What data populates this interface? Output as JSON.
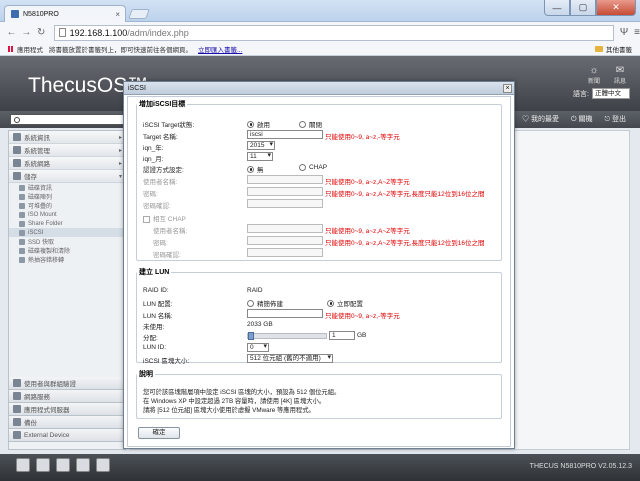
{
  "browser": {
    "tab_title": "N5810PRO",
    "url_host": "192.168.1.100",
    "url_path": "/adm/index.php",
    "bookmarks": {
      "apps_label": "應用程式",
      "hint_text": "將書籤放置於書籤列上，即可快速前往各個網頁。",
      "import_link": "立即匯入書籤...",
      "other_label": "其他書籤"
    },
    "window_buttons": [
      "—",
      "▢",
      "✕"
    ]
  },
  "app": {
    "logo": "ThecusOS™",
    "header_icons": [
      {
        "icon": "rss-icon",
        "label": "新聞"
      },
      {
        "icon": "chat-icon",
        "label": "訊息"
      }
    ],
    "language_label": "語言:",
    "language_value": "正體中文",
    "action_links": [
      "我的最愛",
      "關機",
      "登出"
    ],
    "version": "THECUS N5810PRO V2.05.12.3"
  },
  "sidebar": {
    "sections": [
      {
        "label": "系統資訊"
      },
      {
        "label": "系統管理"
      },
      {
        "label": "系統網路"
      },
      {
        "label": "儲存"
      }
    ],
    "storage_items": [
      {
        "label": "磁碟資訊"
      },
      {
        "label": "磁碟陣列"
      },
      {
        "label": "可堆疊的"
      },
      {
        "label": "ISO Mount"
      },
      {
        "label": "Share Folder"
      },
      {
        "label": "iSCSI"
      },
      {
        "label": "SSD 快取"
      },
      {
        "label": "磁碟複製和清除"
      },
      {
        "label": "熱抽容錯移轉"
      }
    ],
    "bottom_sections": [
      {
        "label": "使用者與群組驗證"
      },
      {
        "label": "網路服務"
      },
      {
        "label": "應用程式伺服器"
      },
      {
        "label": "備份"
      },
      {
        "label": "External Device"
      }
    ]
  },
  "dialog": {
    "title": "iSCSI",
    "close_label": "×",
    "target_section": {
      "legend": "增加iSCSI目標",
      "iscsi_target_label": "iSCSI Target狀態:",
      "enable_label": "啟用",
      "disable_label": "關閉",
      "target_name_label": "Target 名稱:",
      "target_name_value": "iscsi",
      "name_hint": "只能使用0~9, a~z,-等字元",
      "iqn_year_label": "iqn_年:",
      "iqn_year_value": "2015",
      "iqn_month_label": "iqn_月:",
      "iqn_month_value": "11",
      "auth_label": "認證方式設定:",
      "auth_none_label": "無",
      "auth_chap_label": "CHAP",
      "username_label": "使用者名稱:",
      "username_hint": "只能使用0~9, a~z,A~Z等字元",
      "password_label": "密碼:",
      "password_hint": "只能使用0~9, a~z,A~Z等字元,長度只能12位到16位之間",
      "password_confirm_label": "密碼確認:",
      "mutual_chap_label": "相互 CHAP",
      "m_username_label": "使用者名稱:",
      "m_username_hint": "只能使用0~9, a~z,A~Z等字元",
      "m_password_label": "密碼:",
      "m_password_hint": "只能使用0~9, a~z,A~Z等字元,長度只能12位到16位之間",
      "m_password_confirm_label": "密碼確認:"
    },
    "lun_section": {
      "legend": "建立 LUN",
      "raid_id_label": "RAID ID:",
      "raid_id_value": "RAID",
      "lun_alloc_label": "LUN 配置:",
      "thin_label": "精簡佈建",
      "instant_label": "立即配置",
      "lun_name_label": "LUN 名稱:",
      "lun_name_hint": "只能使用0~9, a~z,-等字元",
      "unused_label": "未使用:",
      "unused_value": "2033 GB",
      "allocation_label": "分配:",
      "allocation_value": "1",
      "allocation_unit": "GB",
      "allocation_fraction": 0.0005,
      "lun_id_label": "LUN ID:",
      "lun_id_value": "0",
      "block_size_label": "iSCSI 區塊大小:",
      "block_size_value": "512 位元組 (舊的不適用)"
    },
    "desc_section": {
      "legend": "說明",
      "lines": [
        "您可於該區塊階層項中設定 iSCSI 區塊的大小，預設為 512 個位元組。",
        "在 Windows XP 中設定超過 2TB 容量時，請使用 [4K] 區塊大小。",
        "請將 [512 位元組] 區塊大小使用於虛擬 VMware 等應用程式。"
      ]
    },
    "ok_label": "確定"
  }
}
